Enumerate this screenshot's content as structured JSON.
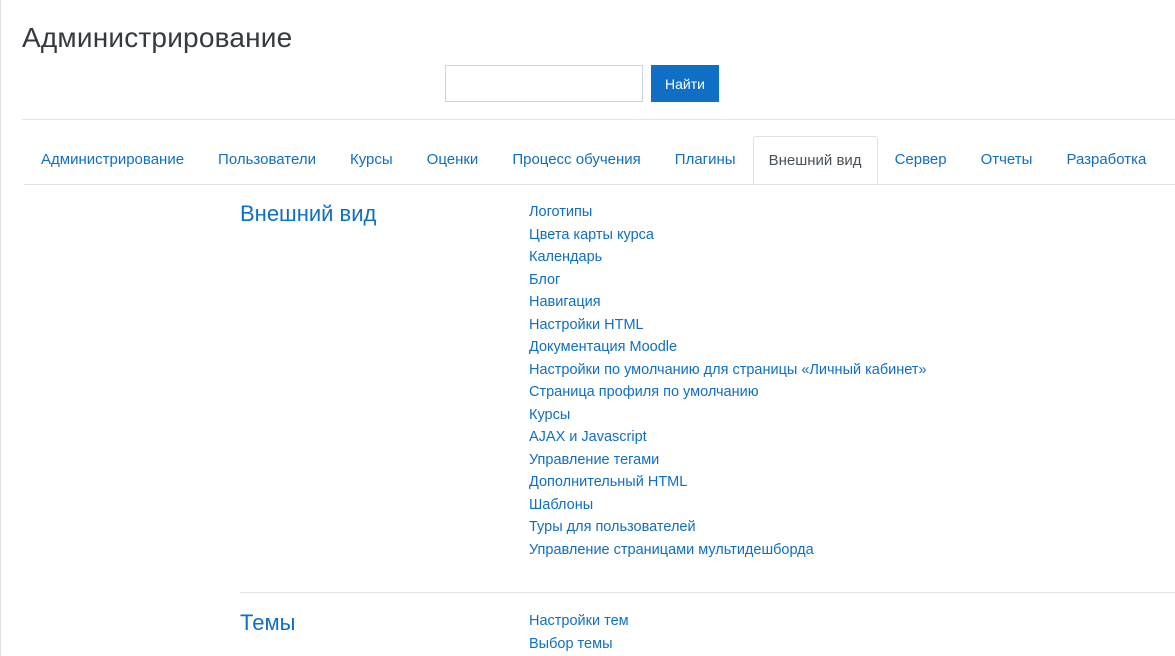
{
  "header": {
    "title": "Администрирование"
  },
  "search": {
    "value": "",
    "placeholder": "",
    "button_label": "Найти"
  },
  "tabs": [
    {
      "label": "Администрирование",
      "active": false
    },
    {
      "label": "Пользователи",
      "active": false
    },
    {
      "label": "Курсы",
      "active": false
    },
    {
      "label": "Оценки",
      "active": false
    },
    {
      "label": "Процесс обучения",
      "active": false
    },
    {
      "label": "Плагины",
      "active": false
    },
    {
      "label": "Внешний вид",
      "active": true
    },
    {
      "label": "Сервер",
      "active": false
    },
    {
      "label": "Отчеты",
      "active": false
    },
    {
      "label": "Разработка",
      "active": false
    }
  ],
  "sections": [
    {
      "title": "Внешний вид",
      "links": [
        "Логотипы",
        "Цвета карты курса",
        "Календарь",
        "Блог",
        "Навигация",
        "Настройки HTML",
        "Документация Moodle",
        "Настройки по умолчанию для страницы «Личный кабинет»",
        "Страница профиля по умолчанию",
        "Курсы",
        "AJAX и Javascript",
        "Управление тегами",
        "Дополнительный HTML",
        "Шаблоны",
        "Туры для пользователей",
        "Управление страницами мультидешборда"
      ]
    },
    {
      "title": "Темы",
      "links": [
        "Настройки тем",
        "Выбор темы"
      ]
    }
  ],
  "colors": {
    "accent": "#0f6fc5",
    "tab_active_text": "#495057",
    "border": "#dee2e6"
  }
}
